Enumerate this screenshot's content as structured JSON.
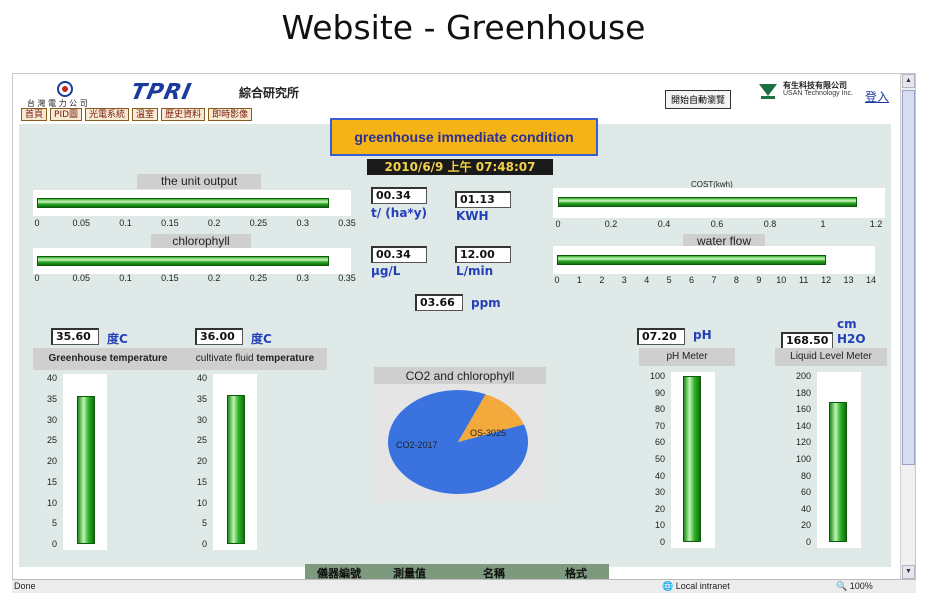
{
  "slide_title": "Website - Greenhouse",
  "header": {
    "institute": "綜合研究所",
    "tpri_logo": "TPRI",
    "auto_browse_button": "開始自動瀏覽",
    "vendor_cn": "有生科技有限公司",
    "vendor_en": "USAN Technology Inc.",
    "login": "登入",
    "nav": [
      "首頁",
      "PID圖",
      "光電系統",
      "溫室",
      "歷史資料",
      "即時影像"
    ]
  },
  "dashboard": {
    "condition_title": "greenhouse immediate condition",
    "datetime": "2010/6/9 上午 07:48:07",
    "unit_output": {
      "label": "the unit output",
      "value": 0.33,
      "max": 0.35,
      "ticks": [
        "0",
        "0.05",
        "0.1",
        "0.15",
        "0.2",
        "0.25",
        "0.3",
        "0.35"
      ],
      "readout": "00.34",
      "unit": "t/ (ha*y)",
      "kwh_readout": "01.13",
      "kwh_unit": "KWH"
    },
    "chlorophyll": {
      "label": "chlorophyll",
      "value": 0.33,
      "max": 0.35,
      "ticks": [
        "0",
        "0.05",
        "0.1",
        "0.15",
        "0.2",
        "0.25",
        "0.3",
        "0.35"
      ],
      "readout": "00.34",
      "unit": "μg/L",
      "flow_readout": "12.00",
      "flow_unit": "L/min"
    },
    "cost": {
      "label": "COST(kwh)",
      "value": 1.13,
      "max": 1.2,
      "ticks": [
        "0",
        "0.2",
        "0.4",
        "0.6",
        "0.8",
        "1",
        "1.2"
      ]
    },
    "water_flow": {
      "label": "water flow",
      "value": 12.0,
      "max": 14,
      "ticks": [
        "0",
        "1",
        "2",
        "3",
        "4",
        "5",
        "6",
        "7",
        "8",
        "9",
        "10",
        "11",
        "12",
        "13",
        "14"
      ]
    },
    "co2_ppm": {
      "readout": "03.66",
      "unit": "ppm"
    },
    "greenhouse_temp": {
      "label": "Greenhouse temperature",
      "readout": "35.60",
      "unit": "度C",
      "value": 35.6,
      "max": 40,
      "ticks": [
        "40",
        "35",
        "30",
        "25",
        "20",
        "15",
        "10",
        "5",
        "0"
      ]
    },
    "fluid_temp": {
      "label_a": "cultivate fluid",
      "label_b": "temperature",
      "readout": "36.00",
      "unit": "度C",
      "value": 36.0,
      "max": 40,
      "ticks": [
        "40",
        "35",
        "30",
        "25",
        "20",
        "15",
        "10",
        "5",
        "0"
      ]
    },
    "ph": {
      "label": "pH Meter",
      "readout": "07.20",
      "unit": "pH",
      "value": 100,
      "max": 100,
      "ticks": [
        "100",
        "90",
        "80",
        "70",
        "60",
        "50",
        "40",
        "30",
        "20",
        "10",
        "0"
      ]
    },
    "liquid_level": {
      "label": "Liquid Level Meter",
      "readout": "168.50",
      "unit_top": "cm",
      "unit_bottom": "H2O",
      "value": 168.5,
      "max": 200,
      "ticks": [
        "200",
        "180",
        "160",
        "140",
        "120",
        "100",
        "80",
        "60",
        "40",
        "20",
        "0"
      ]
    },
    "pie": {
      "label": "CO2 and chlorophyll",
      "slices": [
        {
          "name": "CO2-2017",
          "value": 2017,
          "color": "#3a73e0"
        },
        {
          "name": "OS-3025",
          "value": 302.5,
          "color": "#f4a93c"
        }
      ]
    },
    "footer": [
      "儀器編號",
      "測量值",
      "名稱",
      "格式"
    ]
  },
  "statusbar": {
    "done": "Done",
    "zone": "Local intranet",
    "zoom": "100%"
  },
  "colors": {
    "accent": "#f4b416",
    "bar_green": "#2fb32b",
    "unit_blue": "#2340b8"
  }
}
